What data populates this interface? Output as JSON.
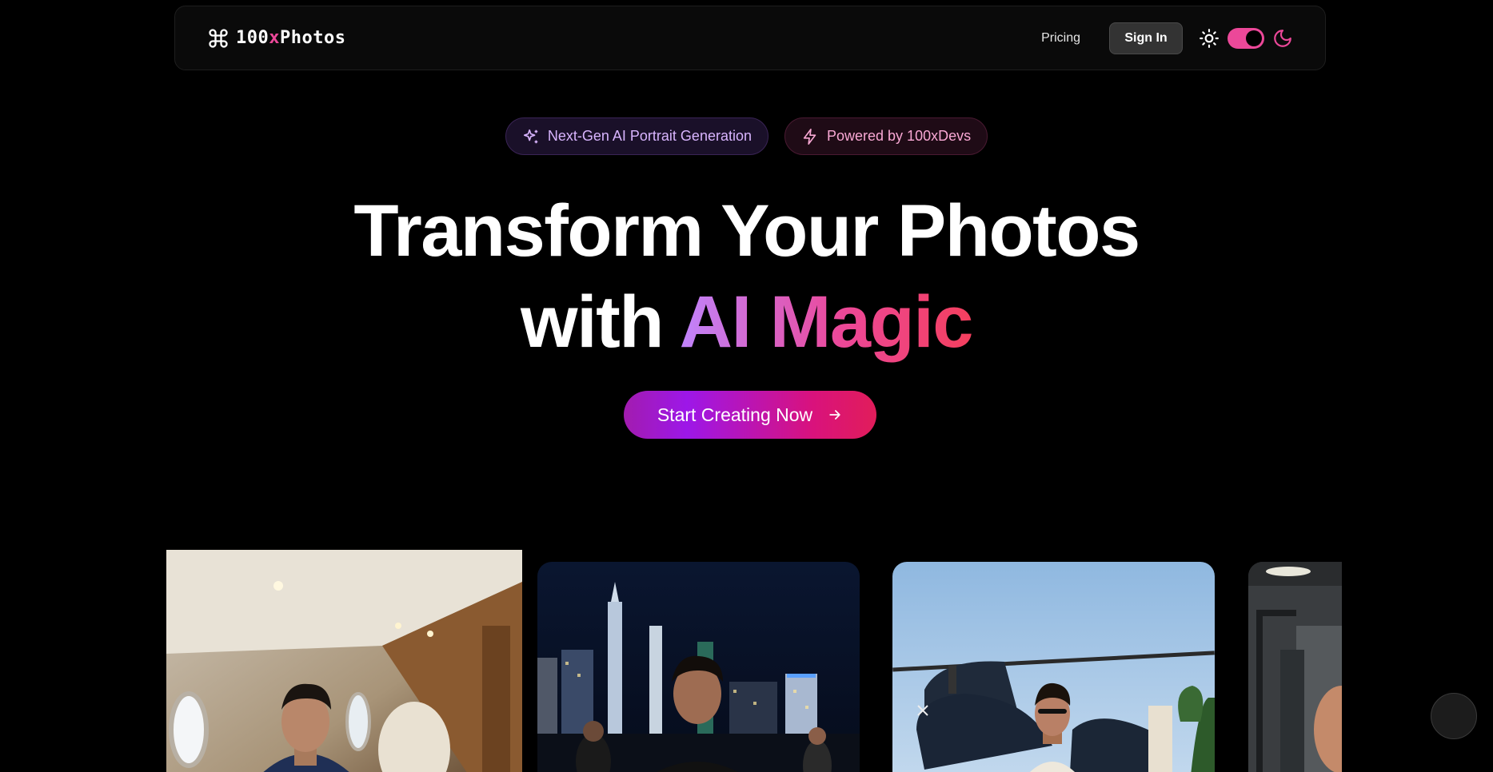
{
  "header": {
    "brand_prefix": "100",
    "brand_x": "x",
    "brand_suffix": "Photos",
    "brand_icon": "command-icon",
    "nav": {
      "pricing": "Pricing",
      "sign_in": "Sign In"
    },
    "theme": {
      "light_icon": "sun-icon",
      "dark_icon": "moon-icon",
      "dark_mode_on": true
    }
  },
  "badges": [
    {
      "label": "Next-Gen AI Portrait Generation",
      "icon": "sparkles-icon"
    },
    {
      "label": "Powered by 100xDevs",
      "icon": "lightning-icon"
    }
  ],
  "hero": {
    "line1": "Transform Your Photos",
    "line2_plain": "with ",
    "line2_gradient": "AI Magic",
    "cta": "Start Creating Now",
    "cta_icon": "arrow-right-icon"
  },
  "gallery": {
    "images": [
      "portrait in private jet cabin",
      "portrait with night city skyline",
      "portrait beside helicopter",
      "portrait in gym"
    ]
  },
  "colors": {
    "accent_pink": "#ec4899",
    "accent_purple": "#c084fc",
    "background": "#000000"
  }
}
